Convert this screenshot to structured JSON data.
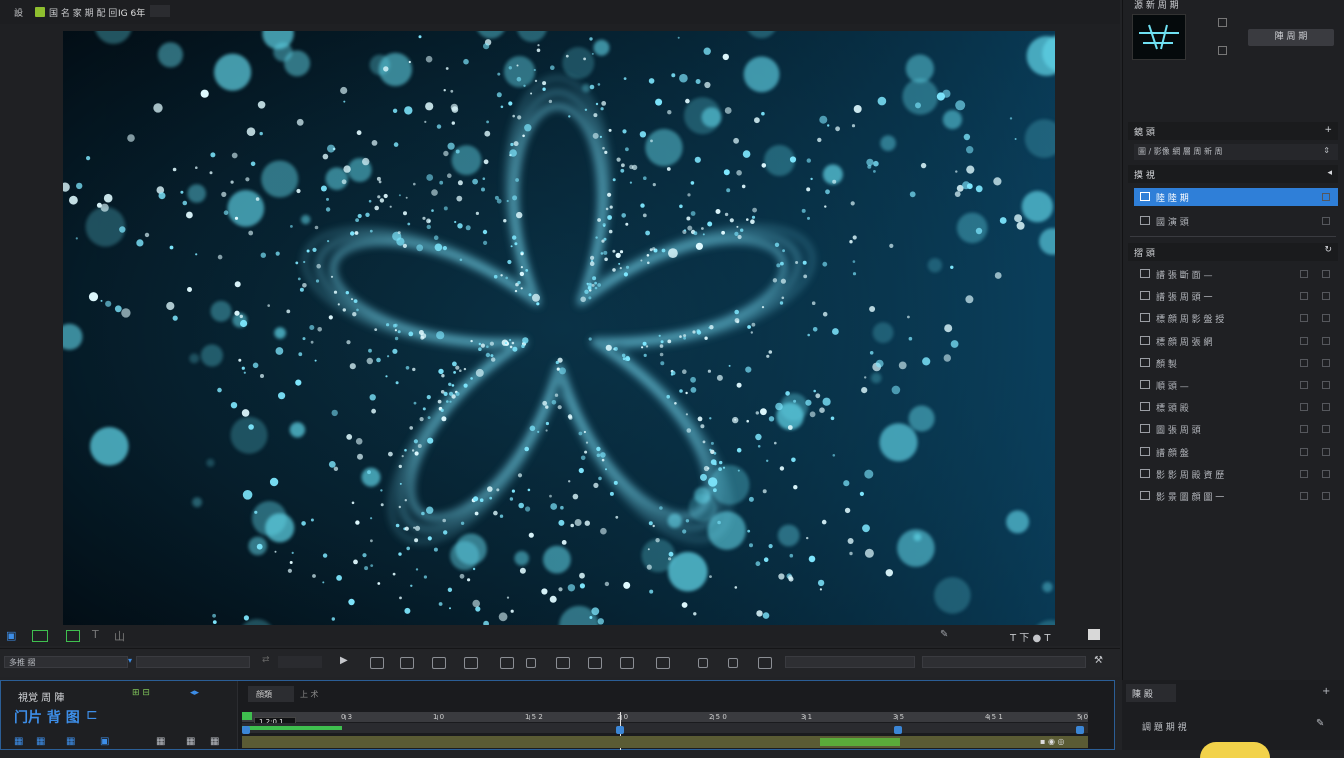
{
  "menubar": {
    "menu_label": "設",
    "title": "国 名 家 期 配 回",
    "tag": "IG 6年"
  },
  "viewer": {
    "name": "particle-star-render"
  },
  "view_toolbar": {
    "left_items": [
      "▣",
      "▤",
      "▥",
      "T",
      "山"
    ],
    "right_text": "T 下 ● T"
  },
  "control_bar": {
    "dropdown": "多推 摺",
    "tools": [
      "▶",
      "◻",
      "▦",
      "▦",
      "▦+",
      "▥",
      "▥",
      "▦",
      "▦",
      "▦+",
      "▦",
      "▥",
      "▥",
      "▦"
    ]
  },
  "timeline": {
    "title": "視覚 周 陣",
    "title_icons": "⊞ ⊟",
    "timecode": "门片 背 图",
    "timecode_icon": "⊏",
    "buttons": [
      "▦",
      "▦",
      "▦",
      "▣",
      "▦",
      "▦",
      "▦"
    ],
    "tab1": "顔類",
    "tab2": "上 术",
    "current_time": "1 2:0 1",
    "ticks": [
      "0 3",
      "1 0",
      "1 5 2",
      "2 0",
      "2 5 0",
      "3 1",
      "3 5",
      "4 5 1",
      "5 0",
      "6 0"
    ]
  },
  "right_panel": {
    "top_title": "源 新 周 期",
    "top_button": "陣 周 期",
    "section1": {
      "title": "鏡 頭",
      "dropdown": "圖 / 影像 網 層 周 新 周"
    },
    "section2": {
      "title": "摸 視",
      "items": [
        {
          "label": "陸 陸 期",
          "selected": true
        },
        {
          "label": "國 演 頭",
          "selected": false
        }
      ]
    },
    "section3": {
      "title": "摺 頭",
      "items": [
        "譜 張 斷 面 —",
        "譜 張 周 頭 一",
        "標 顔 周 影 盤 授",
        "標 顔 周 張 網",
        "顏 製",
        "順 頭 —",
        "標 頭 殿",
        "圖 張 周 頭",
        "譜 顔 盤",
        "影 影 周 殿 資 歷",
        "影 景 圖 顔 圖 一"
      ]
    },
    "bottom": {
      "title": "陳 殿",
      "item": "調 題 期 視"
    }
  },
  "colors": {
    "accent": "#2f7fd8",
    "particle": "#7fe8ff",
    "bg": "#222326"
  }
}
